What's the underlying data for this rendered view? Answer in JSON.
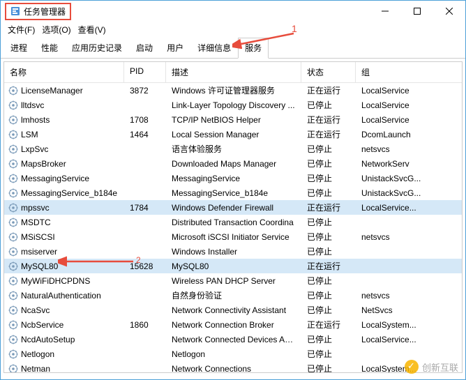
{
  "title": "任务管理器",
  "menu": {
    "file": "文件(F)",
    "options": "选项(O)",
    "view": "查看(V)"
  },
  "tabs": [
    "进程",
    "性能",
    "应用历史记录",
    "启动",
    "用户",
    "详细信息",
    "服务"
  ],
  "activeTab": 6,
  "annotations": {
    "a1": "1",
    "a2": "2"
  },
  "columns": {
    "name": "名称",
    "pid": "PID",
    "desc": "描述",
    "status": "状态",
    "group": "组"
  },
  "rows": [
    {
      "name": "LicenseManager",
      "pid": "3872",
      "desc": "Windows 许可证管理器服务",
      "status": "正在运行",
      "group": "LocalService",
      "hl": false
    },
    {
      "name": "lltdsvc",
      "pid": "",
      "desc": "Link-Layer Topology Discovery ...",
      "status": "已停止",
      "group": "LocalService",
      "hl": false
    },
    {
      "name": "lmhosts",
      "pid": "1708",
      "desc": "TCP/IP NetBIOS Helper",
      "status": "正在运行",
      "group": "LocalService",
      "hl": false
    },
    {
      "name": "LSM",
      "pid": "1464",
      "desc": "Local Session Manager",
      "status": "正在运行",
      "group": "DcomLaunch",
      "hl": false
    },
    {
      "name": "LxpSvc",
      "pid": "",
      "desc": "语言体验服务",
      "status": "已停止",
      "group": "netsvcs",
      "hl": false
    },
    {
      "name": "MapsBroker",
      "pid": "",
      "desc": "Downloaded Maps Manager",
      "status": "已停止",
      "group": "NetworkServ",
      "hl": false
    },
    {
      "name": "MessagingService",
      "pid": "",
      "desc": "MessagingService",
      "status": "已停止",
      "group": "UnistackSvcG...",
      "hl": false
    },
    {
      "name": "MessagingService_b184e",
      "pid": "",
      "desc": "MessagingService_b184e",
      "status": "已停止",
      "group": "UnistackSvcG...",
      "hl": false
    },
    {
      "name": "mpssvc",
      "pid": "1784",
      "desc": "Windows Defender Firewall",
      "status": "正在运行",
      "group": "LocalService...",
      "hl": true
    },
    {
      "name": "MSDTC",
      "pid": "",
      "desc": "Distributed Transaction Coordina",
      "status": "已停止",
      "group": "",
      "hl": false
    },
    {
      "name": "MSiSCSI",
      "pid": "",
      "desc": "Microsoft iSCSI Initiator Service",
      "status": "已停止",
      "group": "netsvcs",
      "hl": false
    },
    {
      "name": "msiserver",
      "pid": "",
      "desc": "Windows Installer",
      "status": "已停止",
      "group": "",
      "hl": false
    },
    {
      "name": "MySQL80",
      "pid": "15628",
      "desc": "MySQL80",
      "status": "正在运行",
      "group": "",
      "hl": true
    },
    {
      "name": "MyWiFiDHCPDNS",
      "pid": "",
      "desc": "Wireless PAN DHCP Server",
      "status": "已停止",
      "group": "",
      "hl": false
    },
    {
      "name": "NaturalAuthentication",
      "pid": "",
      "desc": "自然身份验证",
      "status": "已停止",
      "group": "netsvcs",
      "hl": false
    },
    {
      "name": "NcaSvc",
      "pid": "",
      "desc": "Network Connectivity Assistant",
      "status": "已停止",
      "group": "NetSvcs",
      "hl": false
    },
    {
      "name": "NcbService",
      "pid": "1860",
      "desc": "Network Connection Broker",
      "status": "正在运行",
      "group": "LocalSystem...",
      "hl": false
    },
    {
      "name": "NcdAutoSetup",
      "pid": "",
      "desc": "Network Connected Devices Aut...",
      "status": "已停止",
      "group": "LocalService...",
      "hl": false
    },
    {
      "name": "Netlogon",
      "pid": "",
      "desc": "Netlogon",
      "status": "已停止",
      "group": "",
      "hl": false
    },
    {
      "name": "Netman",
      "pid": "",
      "desc": "Network Connections",
      "status": "已停止",
      "group": "LocalSystem...",
      "hl": false
    }
  ],
  "watermark": "创新互联"
}
